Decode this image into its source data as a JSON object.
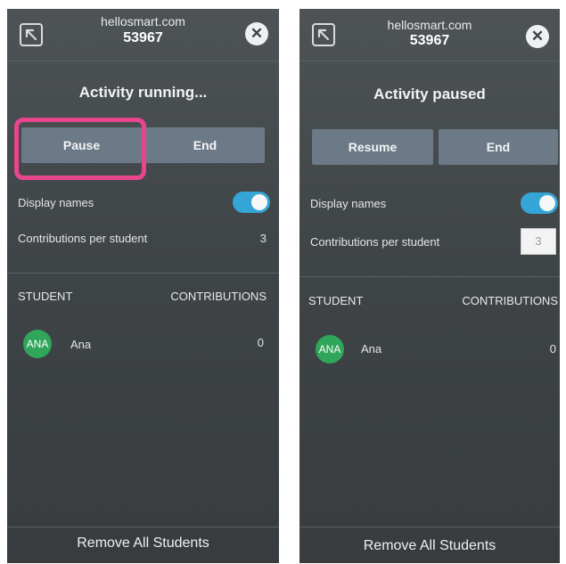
{
  "left": {
    "header": {
      "url": "hellosmart.com",
      "code": "53967",
      "close_glyph": "✕"
    },
    "status": "Activity running...",
    "buttons": {
      "primary_label": "Pause",
      "secondary_label": "End"
    },
    "settings": {
      "display_names_label": "Display names",
      "display_names_on": true,
      "contributions_label": "Contributions per student",
      "contributions_value": "3"
    },
    "table": {
      "col_student": "STUDENT",
      "col_contributions": "CONTRIBUTIONS",
      "rows": [
        {
          "initials": "ANA",
          "name": "Ana",
          "count": "0"
        }
      ]
    },
    "footer_label": "Remove All Students"
  },
  "right": {
    "header": {
      "url": "hellosmart.com",
      "code": "53967",
      "close_glyph": "✕"
    },
    "status": "Activity paused",
    "buttons": {
      "primary_label": "Resume",
      "secondary_label": "End"
    },
    "settings": {
      "display_names_label": "Display names",
      "display_names_on": true,
      "contributions_label": "Contributions per student",
      "contributions_value": "3"
    },
    "table": {
      "col_student": "STUDENT",
      "col_contributions": "CONTRIBUTIONS",
      "rows": [
        {
          "initials": "ANA",
          "name": "Ana",
          "count": "0"
        }
      ]
    },
    "footer_label": "Remove All Students"
  },
  "colors": {
    "accent": "#35a4d6",
    "highlight": "#e8458f",
    "avatar": "#2fa65a",
    "button": "#6c7a87"
  }
}
